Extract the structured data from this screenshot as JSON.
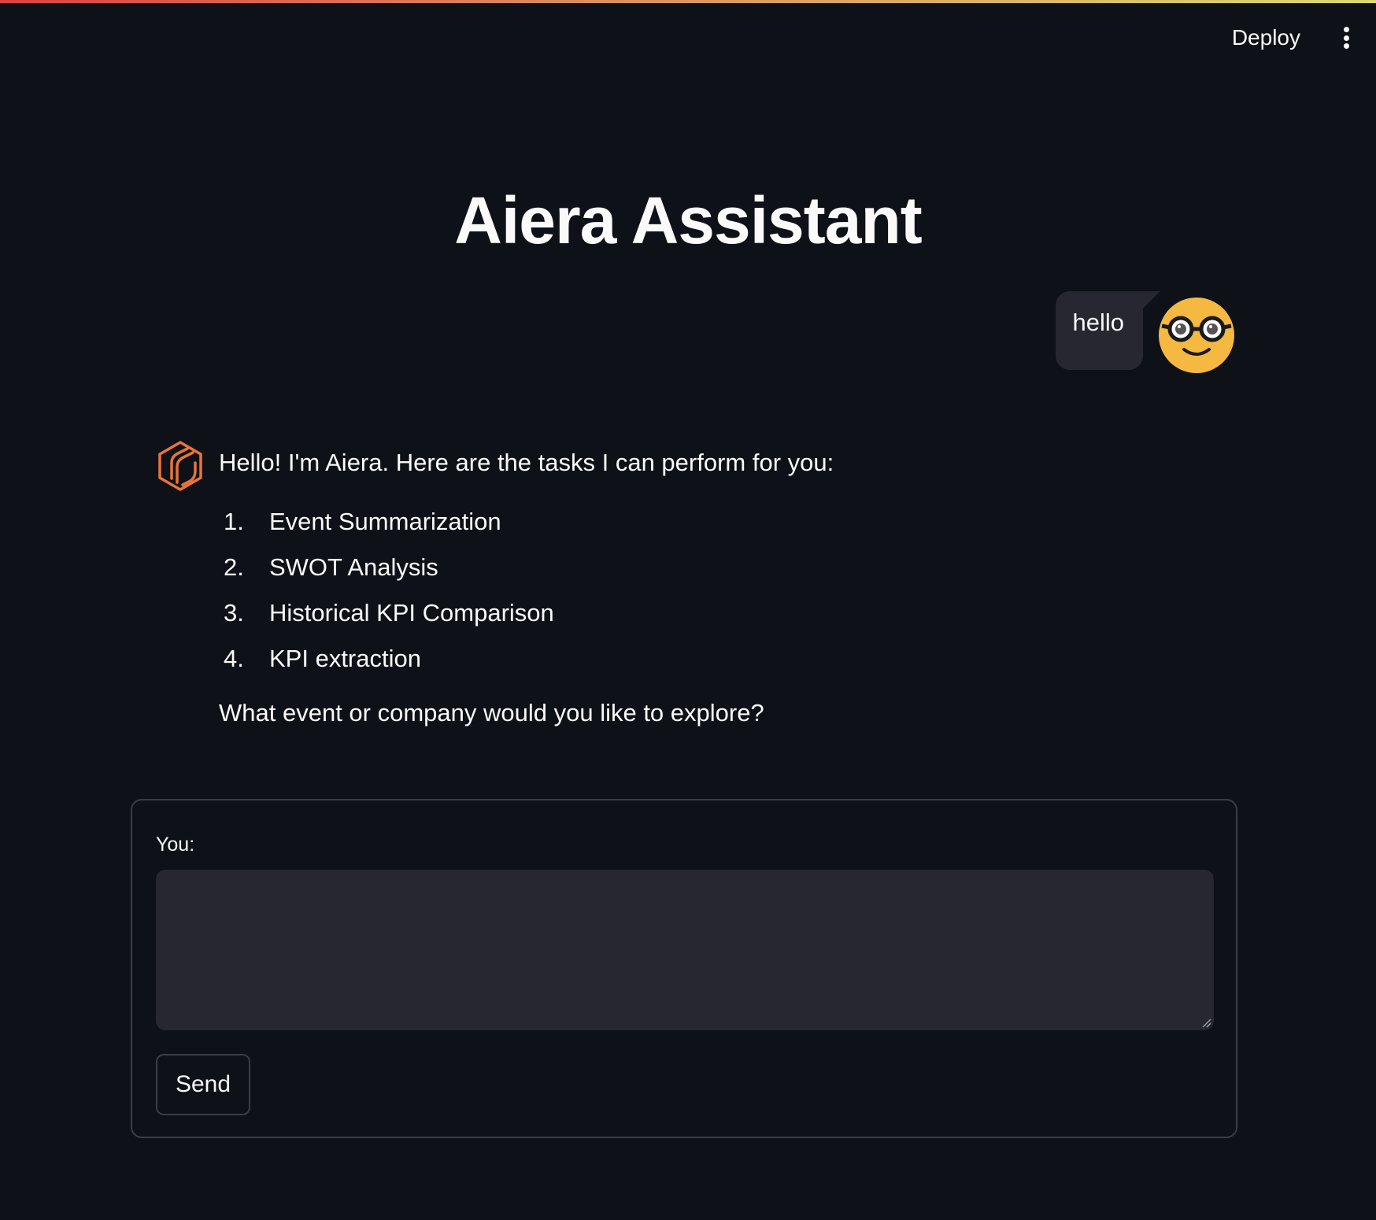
{
  "header": {
    "deploy_label": "Deploy",
    "menu_icon": "kebab-menu-icon"
  },
  "page": {
    "title": "Aiera Assistant"
  },
  "chat": {
    "user_message": {
      "text": "hello",
      "avatar_icon": "nerd-face-emoji-icon",
      "avatar_color": "#f5b942"
    },
    "assistant_message": {
      "avatar_icon": "aiera-logo-icon",
      "avatar_color": "#e8743b",
      "intro": "Hello! I'm Aiera. Here are the tasks I can perform for you:",
      "tasks": [
        {
          "num": "1.",
          "label": "Event Summarization"
        },
        {
          "num": "2.",
          "label": "SWOT Analysis"
        },
        {
          "num": "3.",
          "label": "Historical KPI Comparison"
        },
        {
          "num": "4.",
          "label": "KPI extraction"
        }
      ],
      "question": "What event or company would you like to explore?"
    }
  },
  "form": {
    "label": "You:",
    "input_value": "",
    "placeholder": "",
    "send_label": "Send"
  },
  "colors": {
    "background": "#0e1117",
    "input_bg": "#262730",
    "border": "#3a3d47",
    "text": "#fafafa"
  }
}
